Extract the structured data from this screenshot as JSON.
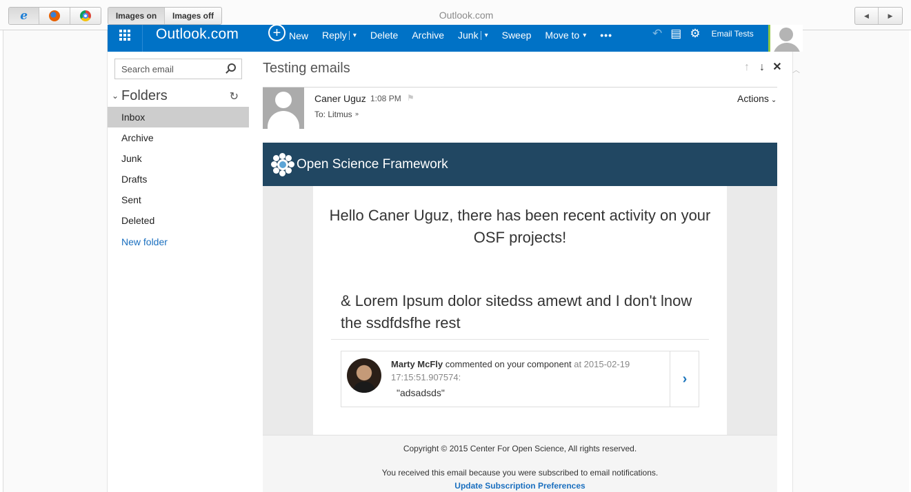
{
  "chrome": {
    "title": "Outlook.com",
    "images_on": "Images on",
    "images_off": "Images off",
    "browsers": [
      "ie-icon",
      "firefox-icon",
      "chrome-icon"
    ],
    "prev_glyph": "◀",
    "next_glyph": "▶"
  },
  "topbar": {
    "brand": "Outlook.com",
    "commands": {
      "new": "New",
      "reply": "Reply",
      "delete": "Delete",
      "archive": "Archive",
      "junk": "Junk",
      "sweep": "Sweep",
      "move_to": "Move to",
      "more": "•••"
    },
    "account_name": "Email Tests",
    "accent_color": "#0072c6"
  },
  "sidebar": {
    "search_placeholder": "Search email",
    "folders_title": "Folders",
    "folders": [
      {
        "label": "Inbox",
        "selected": true
      },
      {
        "label": "Archive"
      },
      {
        "label": "Junk"
      },
      {
        "label": "Drafts"
      },
      {
        "label": "Sent"
      },
      {
        "label": "Deleted"
      }
    ],
    "new_folder": "New folder"
  },
  "message": {
    "subject": "Testing emails",
    "sender": "Caner Uguz",
    "time": "1:08 PM",
    "to": "To: Litmus",
    "actions": "Actions"
  },
  "email": {
    "brand_name": "Open Science Framework",
    "banner_color": "#214762",
    "greeting": "Hello Caner Uguz, there has been recent activity on your OSF projects!",
    "lorem": "& Lorem Ipsum dolor sitedss amewt and I don't lnow the ssdfdsfhe rest",
    "activity": {
      "user": "Marty McFly",
      "verb": "commented on your component",
      "at": "at 2015-02-19 17:15:51.907574:",
      "comment": "\"adsadsds\""
    },
    "copyright": "Copyright © 2015 Center For Open Science, All rights reserved.",
    "subscription_note": "You received this email because you were subscribed to email notifications.",
    "update_link": "Update Subscription Preferences"
  }
}
